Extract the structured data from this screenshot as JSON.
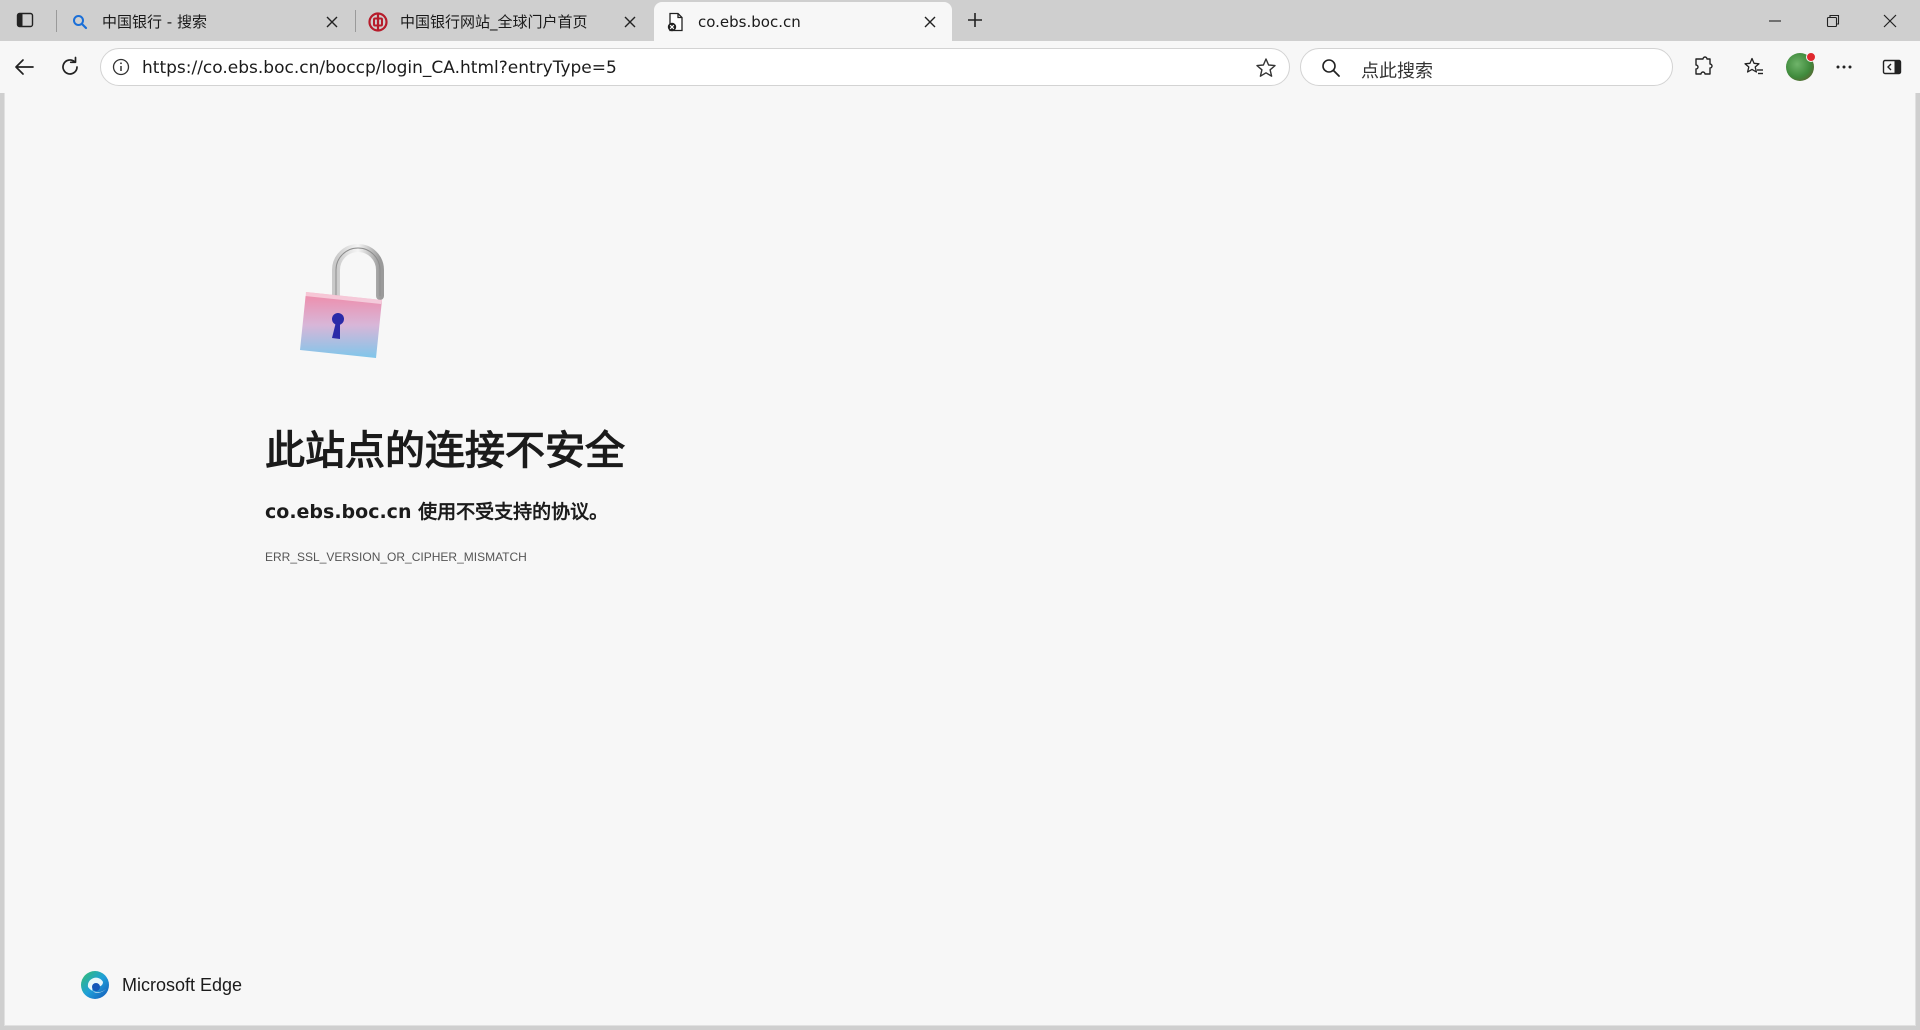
{
  "tabs": [
    {
      "title": "中国银行 - 搜索",
      "icon": "search-favicon-icon",
      "active": false
    },
    {
      "title": "中国银行网站_全球门户首页",
      "icon": "boc-logo-favicon-icon",
      "active": false
    },
    {
      "title": "co.ebs.boc.cn",
      "icon": "insecure-page-icon",
      "active": true
    }
  ],
  "address_bar": {
    "url": "https://co.ebs.boc.cn/boccp/login_CA.html?entryType=5"
  },
  "search_box": {
    "placeholder": "点此搜索"
  },
  "error_page": {
    "heading": "此站点的连接不安全",
    "description": "co.ebs.boc.cn 使用不受支持的协议。",
    "error_code": "ERR_SSL_VERSION_OR_CIPHER_MISMATCH"
  },
  "brand": {
    "name": "Microsoft Edge"
  },
  "colors": {
    "tabstrip": "#cfcfcf",
    "page_background": "#f7f7f7",
    "boc_red": "#b71c2b",
    "edge_blue": "#1a7bd6",
    "edge_green": "#3fbf5a"
  }
}
